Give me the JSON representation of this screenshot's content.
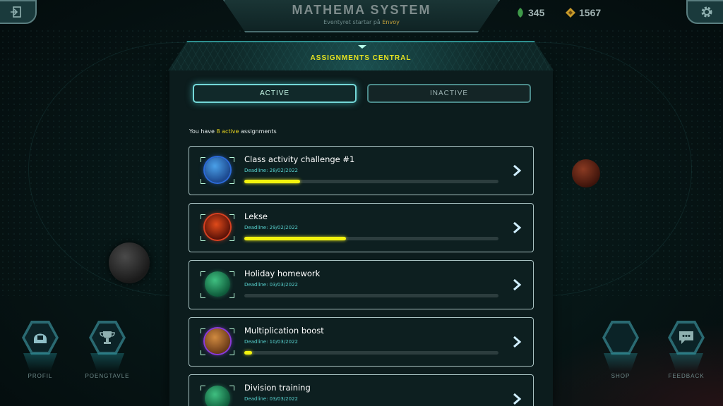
{
  "header": {
    "title": "MATHEMA SYSTEM",
    "subtitle_prefix": "Eventyret startar på",
    "subtitle_place": "Envoy"
  },
  "currency": {
    "gems": "345",
    "coins": "1567"
  },
  "panel": {
    "title": "ASSIGNMENTS CENTRAL",
    "tabs": [
      {
        "label": "ACTIVE",
        "selected": true
      },
      {
        "label": "INACTIVE",
        "selected": false
      }
    ],
    "summary_prefix": "You have",
    "summary_count": "8 active",
    "summary_suffix": "assignments"
  },
  "assignments": [
    {
      "name": "Class activity challenge #1",
      "deadline": "Deadline: 28/02/2022",
      "progress": 0.22,
      "planet": "blue-planet"
    },
    {
      "name": "Lekse",
      "deadline": "Deadline: 29/02/2022",
      "progress": 0.4,
      "planet": "red-planet"
    },
    {
      "name": "Holiday homework",
      "deadline": "Deadline: 03/03/2022",
      "progress": 0.0,
      "planet": "green-planet"
    },
    {
      "name": "Multiplication boost",
      "deadline": "Deadline: 10/03/2022",
      "progress": 0.03,
      "planet": "orange-purple-planet"
    },
    {
      "name": "Division training",
      "deadline": "Deadline: 03/03/2022",
      "progress": 0.0,
      "planet": "green-planet"
    }
  ],
  "nav": {
    "profil": "PROFIL",
    "poengtavle": "POENGTAVLE",
    "shop": "SHOP",
    "feedback": "FEEDBACK"
  },
  "icons": {
    "exit": "exit-icon",
    "settings": "gear-icon",
    "gem": "leaf-gem-icon",
    "coin": "diamond-coin-icon"
  },
  "colors": {
    "accent_yellow": "#e8d51f",
    "teal": "#58d3d0",
    "progress": "#f2f20e"
  }
}
